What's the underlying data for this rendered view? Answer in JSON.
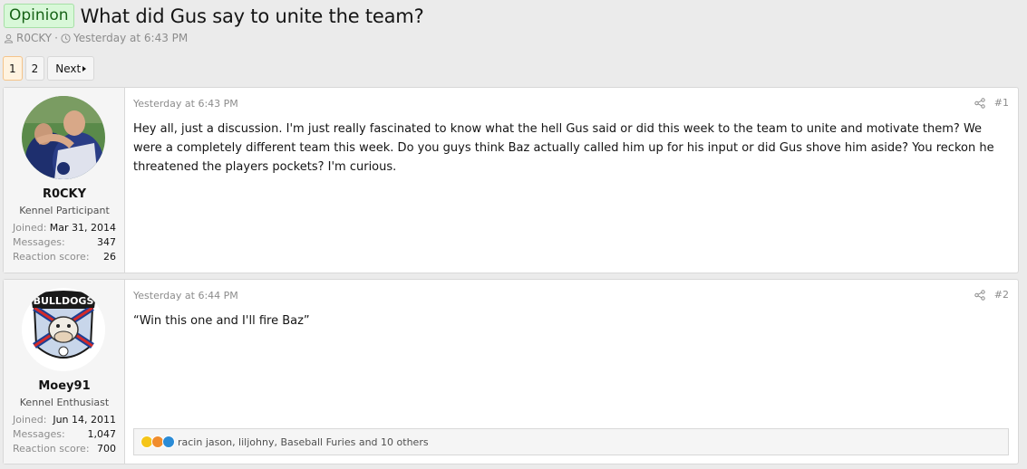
{
  "thread": {
    "prefix": "Opinion",
    "title": "What did Gus say to unite the team?",
    "author": "R0CKY",
    "separator": "·",
    "date": "Yesterday at 6:43 PM"
  },
  "pagination": {
    "pages": [
      "1",
      "2"
    ],
    "current": "1",
    "next_label": "Next"
  },
  "posts": [
    {
      "username": "R0CKY",
      "user_title": "Kennel Participant",
      "stats": [
        {
          "label": "Joined:",
          "value": "Mar 31, 2014"
        },
        {
          "label": "Messages:",
          "value": "347"
        },
        {
          "label": "Reaction score:",
          "value": "26"
        }
      ],
      "date": "Yesterday at 6:43 PM",
      "number": "#1",
      "body": "Hey all, just a discussion. I'm just really fascinated to know what the hell Gus said or did this week to the team to unite and motivate them? We were a completely different team this week. Do you guys think Baz actually called him up for his input or did Gus shove him aside? You reckon he threatened the players pockets? I'm curious."
    },
    {
      "username": "Moey91",
      "user_title": "Kennel Enthusiast",
      "stats": [
        {
          "label": "Joined:",
          "value": "Jun 14, 2011"
        },
        {
          "label": "Messages:",
          "value": "1,047"
        },
        {
          "label": "Reaction score:",
          "value": "700"
        }
      ],
      "date": "Yesterday at 6:44 PM",
      "number": "#2",
      "body": "“Win this one and I'll fire Baz”",
      "reactions_text": "racin jason, liljohny, Baseball Furies and 10 others",
      "avatar_text": "BULLDOGS"
    }
  ],
  "colors": {
    "background": "#ebebeb",
    "prefix_bg": "#d8f8d8",
    "muted": "#8c8c8c",
    "current_page": "#f5c48a"
  }
}
